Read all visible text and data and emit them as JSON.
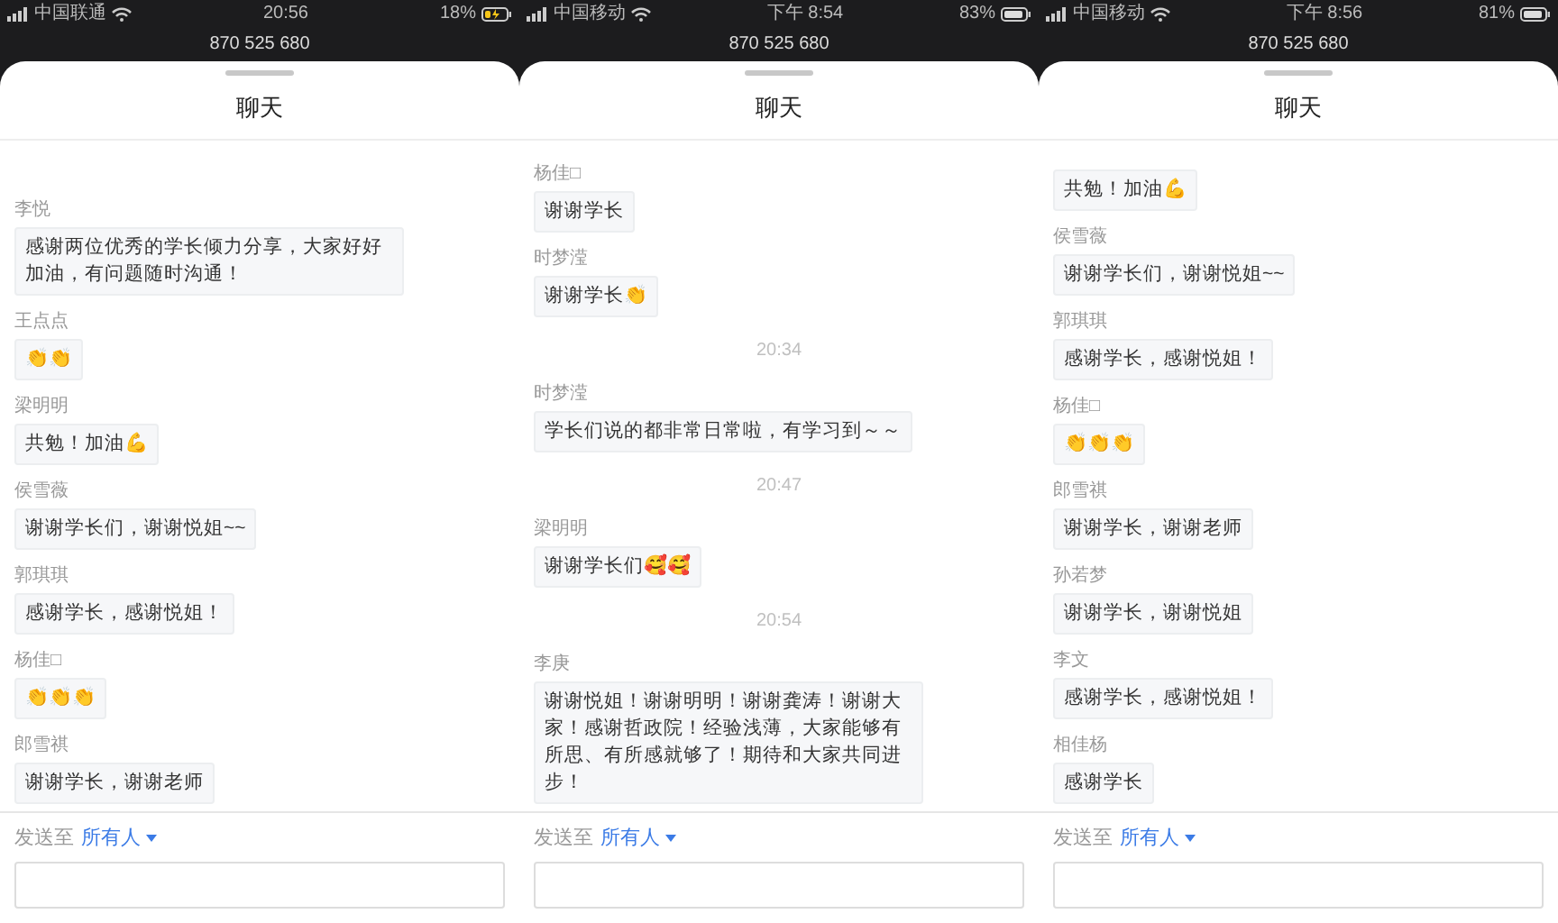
{
  "screens": [
    {
      "status_bar": {
        "carrier": "中国联通",
        "time": "20:56",
        "battery": "18%",
        "charging": true
      },
      "meeting_id": "870 525 680",
      "title": "聊天",
      "messages": [
        {
          "kind": "message",
          "name": "李悦",
          "text": "感谢两位优秀的学长倾力分享，大家好好加油，有问题随时沟通！"
        },
        {
          "kind": "message",
          "name": "王点点",
          "text": "👏👏"
        },
        {
          "kind": "message",
          "name": "梁明明",
          "text": "共勉！加油💪"
        },
        {
          "kind": "message",
          "name": "侯雪薇",
          "text": "谢谢学长们，谢谢悦姐~~"
        },
        {
          "kind": "message",
          "name": "郭琪琪",
          "text": "感谢学长，感谢悦姐！"
        },
        {
          "kind": "message",
          "name": "杨佳□",
          "text": "👏👏👏"
        },
        {
          "kind": "message",
          "name": "郎雪祺",
          "text": "谢谢学长，谢谢老师"
        }
      ],
      "send_to": {
        "label": "发送至",
        "recipient": "所有人"
      }
    },
    {
      "status_bar": {
        "carrier": "中国移动",
        "time": "下午 8:54",
        "battery": "83%",
        "charging": false
      },
      "meeting_id": "870 525 680",
      "title": "聊天",
      "messages": [
        {
          "kind": "message",
          "name": "杨佳□",
          "text": "谢谢学长"
        },
        {
          "kind": "message",
          "name": "时梦滢",
          "text": "谢谢学长👏"
        },
        {
          "kind": "time",
          "text": "20:34"
        },
        {
          "kind": "message",
          "name": "时梦滢",
          "text": "学长们说的都非常日常啦，有学习到～～"
        },
        {
          "kind": "time",
          "text": "20:47"
        },
        {
          "kind": "message",
          "name": "梁明明",
          "text": "谢谢学长们🥰🥰"
        },
        {
          "kind": "time",
          "text": "20:54"
        },
        {
          "kind": "message",
          "name": "李庚",
          "text": "谢谢悦姐！谢谢明明！谢谢龚涛！谢谢大家！感谢哲政院！经验浅薄，大家能够有所思、有所感就够了！期待和大家共同进步！"
        }
      ],
      "send_to": {
        "label": "发送至",
        "recipient": "所有人"
      }
    },
    {
      "status_bar": {
        "carrier": "中国移动",
        "time": "下午 8:56",
        "battery": "81%",
        "charging": false
      },
      "meeting_id": "870 525 680",
      "title": "聊天",
      "messages": [
        {
          "kind": "message",
          "text": "共勉！加油💪"
        },
        {
          "kind": "message",
          "name": "侯雪薇",
          "text": "谢谢学长们，谢谢悦姐~~"
        },
        {
          "kind": "message",
          "name": "郭琪琪",
          "text": "感谢学长，感谢悦姐！"
        },
        {
          "kind": "message",
          "name": "杨佳□",
          "text": "👏👏👏"
        },
        {
          "kind": "message",
          "name": "郎雪祺",
          "text": "谢谢学长，谢谢老师"
        },
        {
          "kind": "message",
          "name": "孙若梦",
          "text": "谢谢学长，谢谢悦姐"
        },
        {
          "kind": "message",
          "name": "李文",
          "text": "感谢学长，感谢悦姐！"
        },
        {
          "kind": "message",
          "name": "相佳杨",
          "text": "感谢学长"
        }
      ],
      "send_to": {
        "label": "发送至",
        "recipient": "所有人"
      }
    }
  ]
}
